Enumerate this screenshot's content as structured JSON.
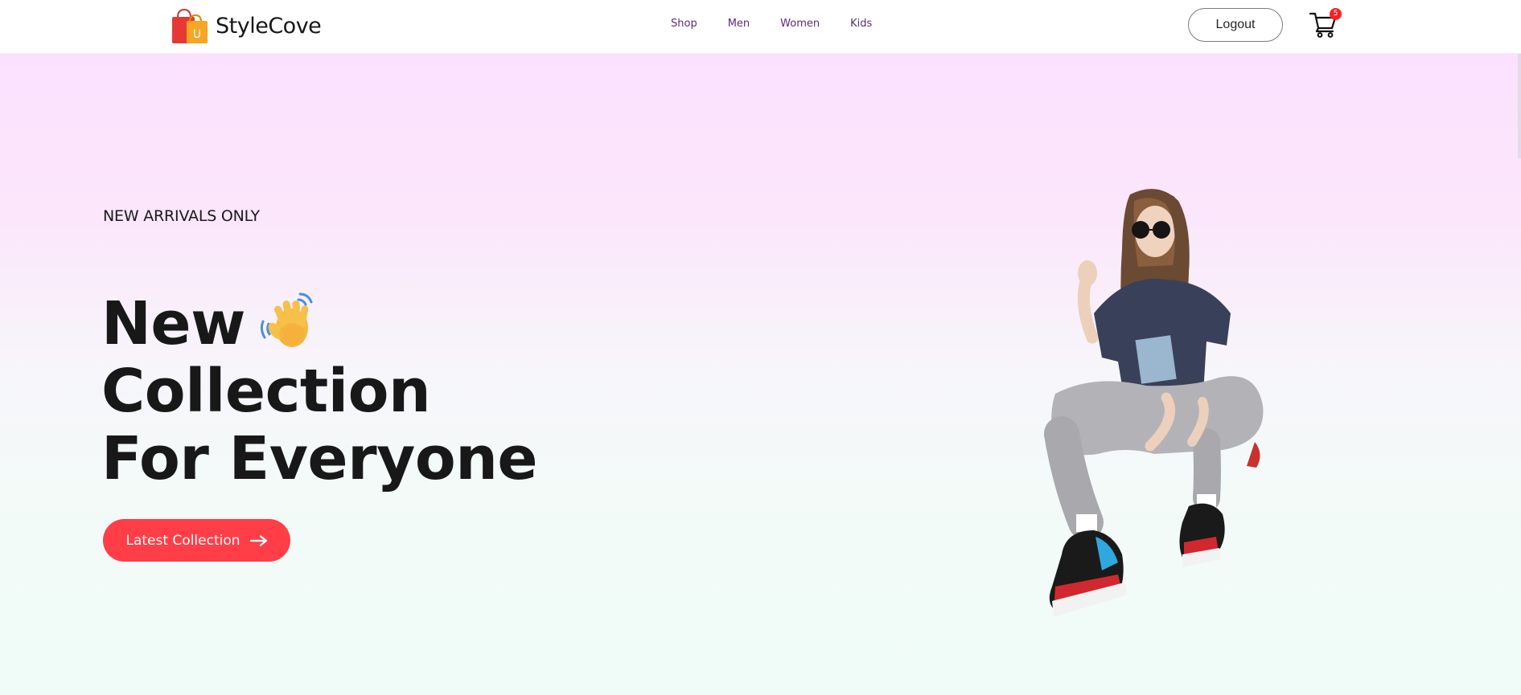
{
  "brand": {
    "name": "StyleCove",
    "logo_icon": "shopping-bag-icon"
  },
  "nav": {
    "items": [
      {
        "label": "Shop"
      },
      {
        "label": "Men"
      },
      {
        "label": "Women"
      },
      {
        "label": "Kids"
      }
    ]
  },
  "header": {
    "logout_label": "Logout",
    "cart_icon": "cart-icon",
    "cart_count": "5"
  },
  "hero": {
    "eyebrow": "NEW ARRIVALS ONLY",
    "title_line1": "New",
    "title_line2": "Collection",
    "title_line3": "For Everyone",
    "wave_icon": "waving-hand-icon",
    "cta_label": "Latest Collection",
    "cta_icon": "arrow-right-icon",
    "image": "hero-model-image"
  },
  "colors": {
    "accent": "#ff3e47",
    "nav_text": "#5b2b7a",
    "badge": "#ff1f1f",
    "gradient_top": "#fbe1fe",
    "gradient_bottom": "#f0fcf8"
  }
}
